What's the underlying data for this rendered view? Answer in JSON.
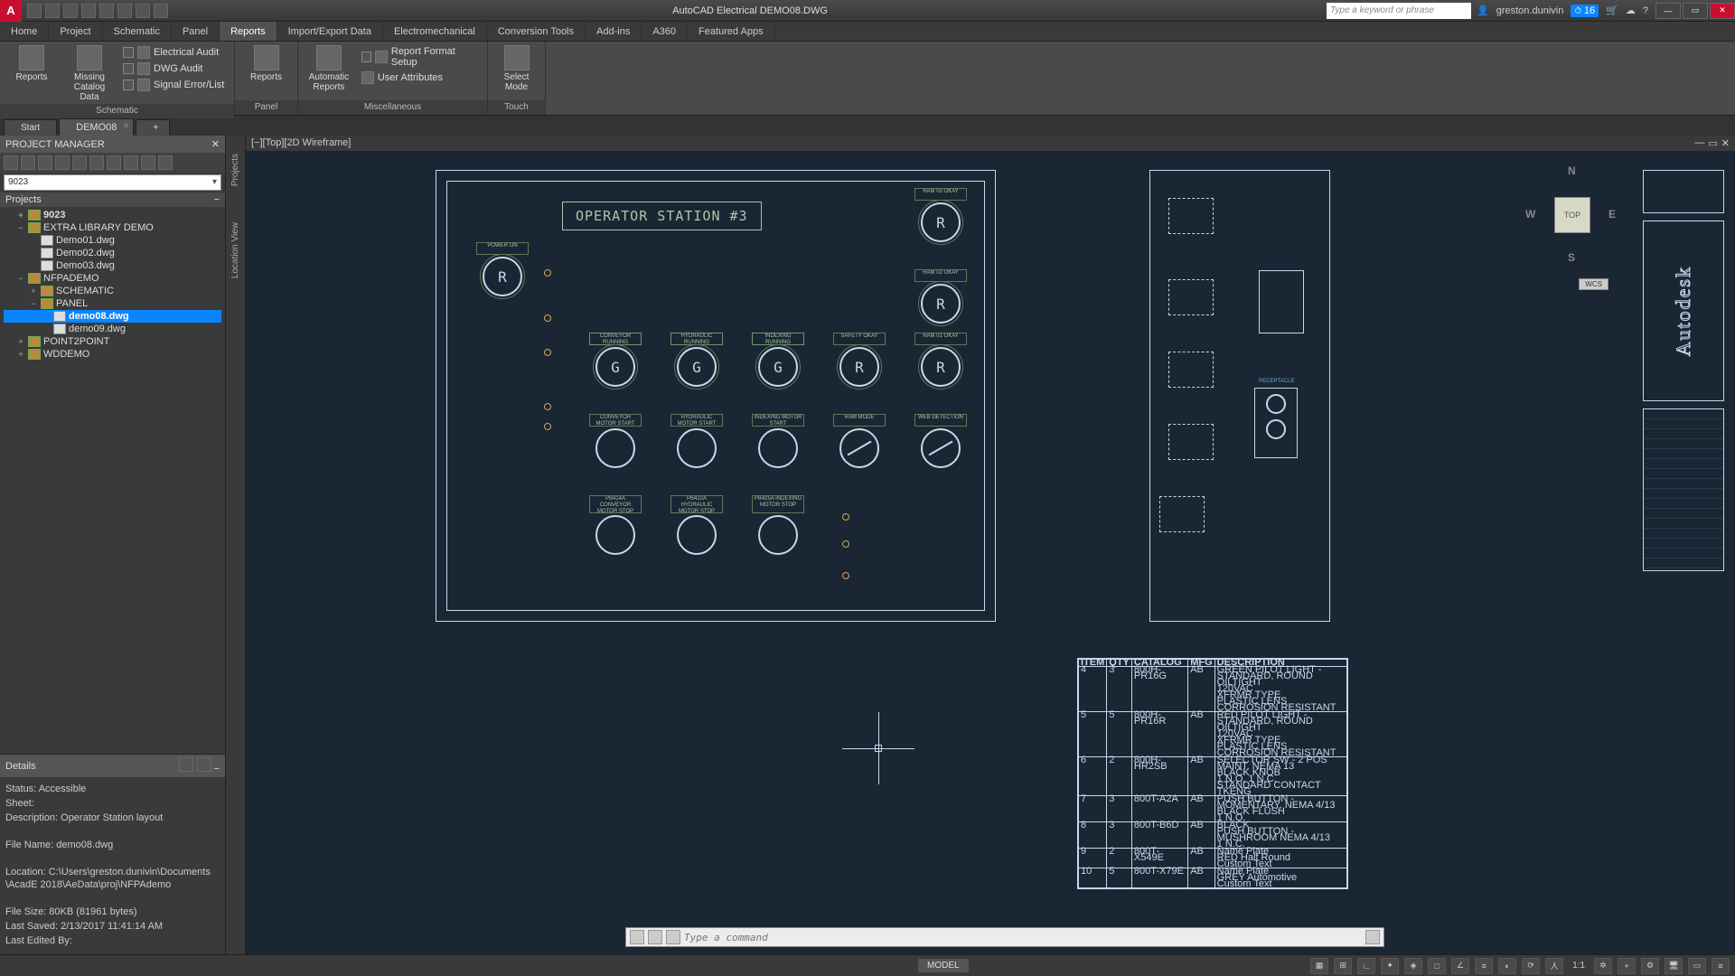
{
  "title": "AutoCAD Electrical   DEMO08.DWG",
  "search_placeholder": "Type a keyword or phrase",
  "user": "greston.dunivin",
  "notif_count": "16",
  "menu": [
    "Home",
    "Project",
    "Schematic",
    "Panel",
    "Reports",
    "Import/Export Data",
    "Electromechanical",
    "Conversion Tools",
    "Add-ins",
    "A360",
    "Featured Apps"
  ],
  "active_menu": 4,
  "ribbon": {
    "schematic": {
      "label": "Schematic",
      "reports": "Reports",
      "missing": "Missing Catalog\nData",
      "audit": "Electrical Audit",
      "dwg_audit": "DWG Audit",
      "signal": "Signal Error/List"
    },
    "panel": {
      "label": "Panel",
      "reports": "Reports"
    },
    "misc": {
      "label": "Miscellaneous",
      "auto": "Automatic\nReports",
      "format": "Report Format Setup",
      "user_attr": "User Attributes"
    },
    "touch": {
      "label": "Touch",
      "select": "Select\nMode"
    }
  },
  "tabs": {
    "start": "Start",
    "file": "DEMO08"
  },
  "pm": {
    "title": "PROJECT MANAGER",
    "combo": "9023",
    "projects": "Projects",
    "tree": [
      {
        "t": "9023",
        "lvl": 1,
        "exp": "+",
        "folder": true,
        "bold": true
      },
      {
        "t": "EXTRA LIBRARY DEMO",
        "lvl": 1,
        "exp": "−",
        "folder": true
      },
      {
        "t": "Demo01.dwg",
        "lvl": 2,
        "file": true
      },
      {
        "t": "Demo02.dwg",
        "lvl": 2,
        "file": true
      },
      {
        "t": "Demo03.dwg",
        "lvl": 2,
        "file": true
      },
      {
        "t": "NFPADEMO",
        "lvl": 1,
        "exp": "−",
        "folder": true
      },
      {
        "t": "SCHEMATIC",
        "lvl": 2,
        "exp": "+",
        "folder": true
      },
      {
        "t": "PANEL",
        "lvl": 2,
        "exp": "−",
        "folder": true
      },
      {
        "t": "demo08.dwg",
        "lvl": 3,
        "file": true,
        "sel": true,
        "bold": true
      },
      {
        "t": "demo09.dwg",
        "lvl": 3,
        "file": true
      },
      {
        "t": "POINT2POINT",
        "lvl": 1,
        "exp": "+",
        "folder": true
      },
      {
        "t": "WDDEMO",
        "lvl": 1,
        "exp": "+",
        "folder": true
      }
    ]
  },
  "vstrip": {
    "projects": "Projects",
    "location": "Location View"
  },
  "details": {
    "title": "Details",
    "status": "Status: Accessible",
    "sheet": "Sheet:",
    "desc": "Description: Operator Station layout",
    "fname": "File Name: demo08.dwg",
    "loc": "Location: C:\\Users\\greston.dunivin\\Documents\\AcadE 2018\\AeData\\proj\\NFPAdemo",
    "size": "File Size: 80KB (81961 bytes)",
    "saved": "Last Saved: 2/13/2017 11:41:14 AM",
    "edited": "Last Edited By:"
  },
  "canvas": {
    "view_label": "[−][Top][2D Wireframe]",
    "station": "OPERATOR STATION #3",
    "nav": {
      "top": "TOP",
      "n": "N",
      "s": "S",
      "e": "E",
      "w": "W"
    },
    "wcs": "WCS",
    "autodesk": "Autodesk",
    "receptacle": "RECEPTACLE",
    "devices": {
      "power_on": "POWER\nON",
      "ram02_okay": "RAM 02\nOKAY",
      "ram03_okay": "RAM 03\nOKAY",
      "conv_run": "CONVEYOR RUNNING",
      "hyd_run": "HYDRAULIC RUNNING",
      "idx_run": "INDEXING RUNNING",
      "safety": "SAFETY\nOKAY",
      "ram01_okay": "RAM 01\nOKAY",
      "conv_start": "CONVEYOR MOTOR\nSTART",
      "hyd_start": "HYDRAULIC MOTOR\nSTART",
      "idx_start": "INDEXING MOTOR\nSTART",
      "ram_mode": "RAM\nMODE",
      "web_det": "WEB DETECTION",
      "conv_stop": "PB414A\nCONVEYOR MOTOR\nSTOP",
      "hyd_stop": "PB422A\nHYDRAULIC MOTOR\nSTOP",
      "idx_stop": "PB425A\nINDEXING MOTOR\nSTOP"
    }
  },
  "bom": {
    "headers": [
      "ITEM",
      "QTY",
      "CATALOG",
      "MFG",
      "DESCRIPTION"
    ],
    "rows": [
      [
        "4",
        "3",
        "800H-PR16G",
        "AB",
        "GREEN PILOT LIGHT - STANDARD, ROUND OILTIGHT\n120VAC\nXFRMR TYPE\nPLASTIC LENS\nCORROSION RESISTANT"
      ],
      [
        "5",
        "5",
        "800H-PR16R",
        "AB",
        "RED PILOT LIGHT - STANDARD, ROUND OILTIGHT\n120VAC\nXFRMR TYPE\nPLASTIC LENS\nCORROSION RESISTANT"
      ],
      [
        "6",
        "2",
        "800H-HR2SB",
        "AB",
        "SELECTOR SW - 2 POS MAINT. NEMA 13\nBLACK KNOB\n1 N.O. 1 N.C.\nSTANDARD CONTACT TKENG"
      ],
      [
        "7",
        "3",
        "800T-A2A",
        "AB",
        "PUSH BUTTON - MOMENTARY, NEMA 4/13\nBLACK FLUSH\n1 N.O."
      ],
      [
        "8",
        "3",
        "800T-B6D",
        "AB",
        "BLACK\nPUSH BUTTON - MUSHROOM NEMA 4/13\n1 N.C."
      ],
      [
        "9",
        "2",
        "800T-X549E",
        "AB",
        "Name Plate\nRED Half Round\nCustom Text"
      ],
      [
        "10",
        "5",
        "800T-X79E",
        "AB",
        "Name Plate\nGREY Automotive\nCustom Text"
      ]
    ]
  },
  "cmd_placeholder": "Type a command",
  "status": {
    "model": "MODEL",
    "ratio": "1:1"
  }
}
